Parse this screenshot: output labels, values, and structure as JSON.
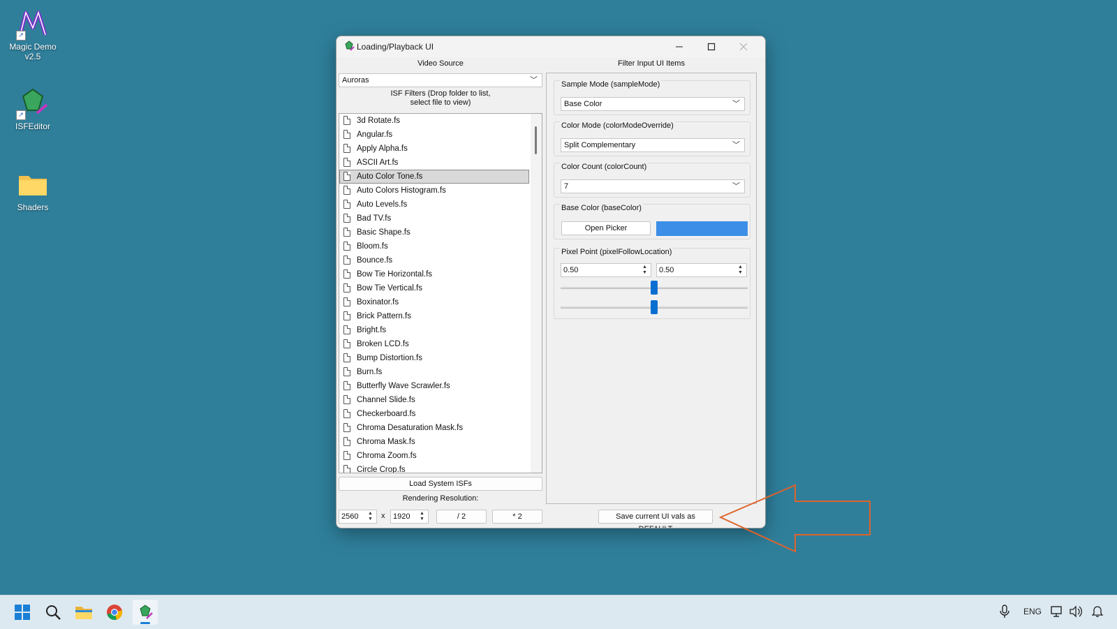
{
  "desktop": {
    "icons": [
      {
        "label": "Magic Demo v2.5"
      },
      {
        "label": "ISFEditor"
      },
      {
        "label": "Shaders"
      }
    ]
  },
  "window": {
    "title": "Loading/Playback UI",
    "video_source": {
      "header": "Video Source",
      "selected": "Auroras"
    },
    "isf_filters_header": "ISF Filters (Drop folder to list, select file to view)",
    "files": [
      "3d Rotate.fs",
      "Angular.fs",
      "Apply Alpha.fs",
      "ASCII Art.fs",
      "Auto Color Tone.fs",
      "Auto Colors Histogram.fs",
      "Auto Levels.fs",
      "Bad TV.fs",
      "Basic Shape.fs",
      "Bloom.fs",
      "Bounce.fs",
      "Bow Tie Horizontal.fs",
      "Bow Tie Vertical.fs",
      "Boxinator.fs",
      "Brick Pattern.fs",
      "Bright.fs",
      "Broken LCD.fs",
      "Bump Distortion.fs",
      "Burn.fs",
      "Butterfly Wave Scrawler.fs",
      "Channel Slide.fs",
      "Checkerboard.fs",
      "Chroma Desaturation Mask.fs",
      "Chroma Mask.fs",
      "Chroma Zoom.fs",
      "Circle Crop.fs"
    ],
    "selected_file": "Auto Color Tone.fs",
    "load_system_label": "Load System ISFs",
    "rendering_resolution_label": "Rendering Resolution:",
    "res_width": "2560",
    "res_x": "x",
    "res_height": "1920",
    "half_label": "/ 2",
    "double_label": "* 2",
    "filter_inputs_header": "Filter Input UI Items",
    "sample_mode": {
      "label": "Sample Mode (sampleMode)",
      "value": "Base Color"
    },
    "color_mode": {
      "label": "Color Mode (colorModeOverride)",
      "value": "Split Complementary"
    },
    "color_count": {
      "label": "Color Count (colorCount)",
      "value": "7"
    },
    "base_color": {
      "label": "Base Color (baseColor)",
      "button": "Open Picker",
      "swatch": "#3c8ee6"
    },
    "pixel_point": {
      "label": "Pixel Point (pixelFollowLocation)",
      "x": "0.50",
      "y": "0.50",
      "slider_x": 0.5,
      "slider_y": 0.5
    },
    "save_default_label": "Save current UI vals as DEFAULT"
  },
  "taskbar": {
    "language": "ENG"
  },
  "colors": {
    "annotation_arrow": "#e0632a",
    "accent": "#0a6ed1"
  }
}
